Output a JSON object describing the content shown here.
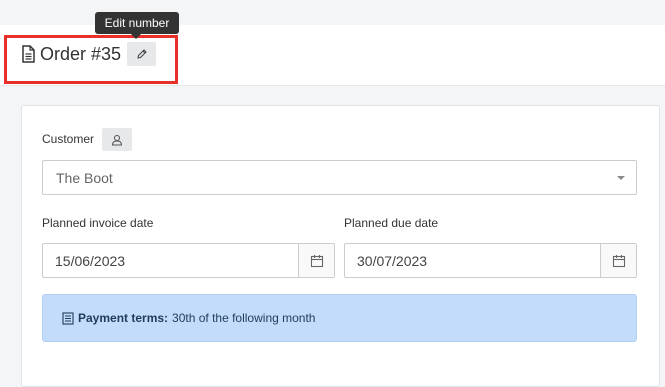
{
  "tooltip": {
    "text": "Edit number"
  },
  "header": {
    "title": "Order #35"
  },
  "customer": {
    "label": "Customer",
    "value": "The Boot"
  },
  "invoice_date": {
    "label": "Planned invoice date",
    "value": "15/06/2023"
  },
  "due_date": {
    "label": "Planned due date",
    "value": "30/07/2023"
  },
  "payment_terms": {
    "label": "Payment terms:",
    "value": "30th of the following month"
  },
  "colors": {
    "highlight": "#e8302b",
    "info_bg": "#c3dcfb",
    "tooltip_bg": "#333333"
  },
  "icons": [
    "document-icon",
    "pencil-icon",
    "user-icon",
    "calendar-icon",
    "chevron-down-icon",
    "list-icon"
  ]
}
